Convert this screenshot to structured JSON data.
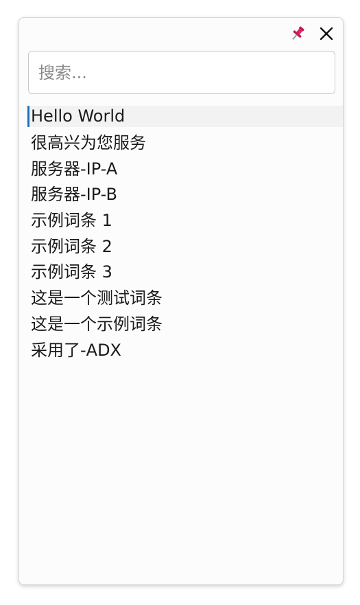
{
  "search": {
    "placeholder": "搜索..."
  },
  "icons": {
    "pin": "pin-icon",
    "close": "close-icon"
  },
  "colors": {
    "pin_red": "#e0245e",
    "selection_accent": "#1f6fb8",
    "selection_bg": "#f2f2f2"
  },
  "list": {
    "items": [
      {
        "label": "Hello World",
        "selected": true
      },
      {
        "label": "很高兴为您服务"
      },
      {
        "label": "服务器-IP-A"
      },
      {
        "label": "服务器-IP-B"
      },
      {
        "label": "示例词条 1"
      },
      {
        "label": "示例词条 2"
      },
      {
        "label": "示例词条 3"
      },
      {
        "label": "这是一个测试词条"
      },
      {
        "label": "这是一个示例词条"
      },
      {
        "label": "采用了-ADX"
      }
    ]
  }
}
